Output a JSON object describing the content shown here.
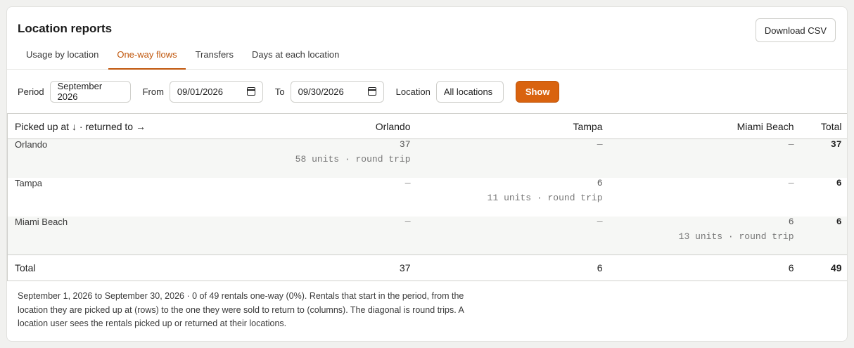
{
  "header": {
    "title": "Location reports",
    "download_label": "Download CSV"
  },
  "tabs": [
    {
      "label": "Usage by location",
      "active": false
    },
    {
      "label": "One-way flows",
      "active": true
    },
    {
      "label": "Transfers",
      "active": false
    },
    {
      "label": "Days at each location",
      "active": false
    }
  ],
  "filters": {
    "period_label": "Period",
    "period_value": "September 2026",
    "from_label": "From",
    "from_value": "09/01/2026",
    "to_label": "To",
    "to_value": "09/30/2026",
    "location_label": "Location",
    "location_value": "All locations",
    "show_label": "Show"
  },
  "table": {
    "corner_header": "Picked up at ↓ · returned to →",
    "columns": [
      "Orlando",
      "Tampa",
      "Miami Beach"
    ],
    "total_header": "Total",
    "rows": [
      {
        "label": "Orlando",
        "cells": [
          {
            "value": "37",
            "sub": "58 units · round trip"
          },
          {
            "value": "—",
            "sub": ""
          },
          {
            "value": "—",
            "sub": ""
          }
        ],
        "total": "37"
      },
      {
        "label": "Tampa",
        "cells": [
          {
            "value": "—",
            "sub": ""
          },
          {
            "value": "6",
            "sub": "11 units · round trip"
          },
          {
            "value": "—",
            "sub": ""
          }
        ],
        "total": "6"
      },
      {
        "label": "Miami Beach",
        "cells": [
          {
            "value": "—",
            "sub": ""
          },
          {
            "value": "—",
            "sub": ""
          },
          {
            "value": "6",
            "sub": "13 units · round trip"
          }
        ],
        "total": "6"
      }
    ],
    "footer": {
      "label": "Total",
      "values": [
        "37",
        "6",
        "6"
      ],
      "grand_total": "49"
    }
  },
  "note": "September 1, 2026 to September 30, 2026 · 0 of 49 rentals one-way (0%). Rentals that start in the period, from the location they are picked up at (rows) to the one they were sold to return to (columns). The diagonal is round trips. A location user sees the rentals picked up or returned at their locations.",
  "colors": {
    "accent": "#d9630f",
    "accent_text": "#c0560b"
  },
  "icons": {
    "date_picker": "calendar-icon"
  }
}
